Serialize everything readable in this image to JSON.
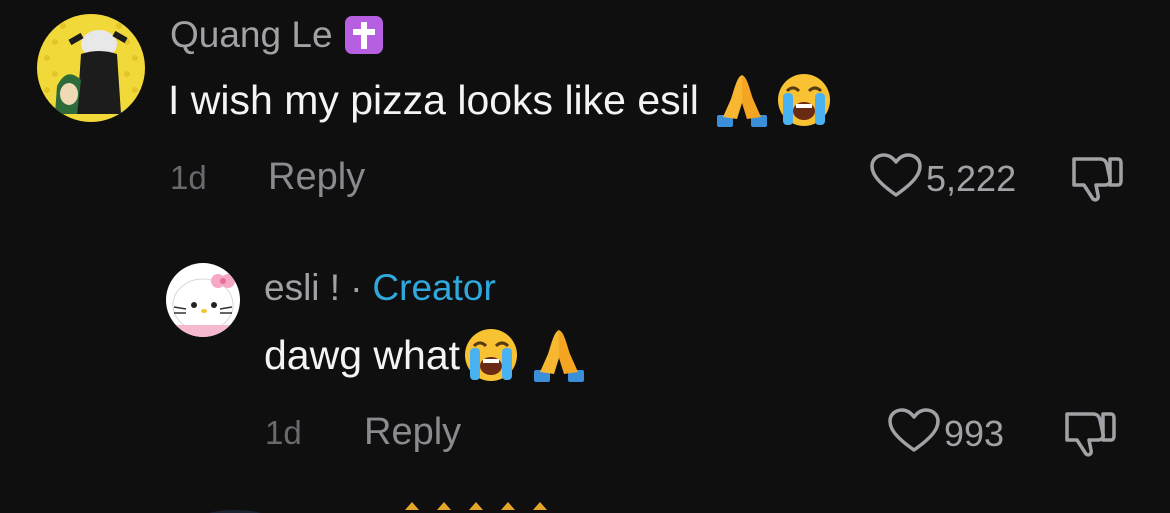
{
  "comments": [
    {
      "author": "Quang Le",
      "badge_icon": "latin-cross-icon",
      "text": "I wish my pizza looks like esil",
      "emojis": [
        "folded-hands-icon",
        "loudly-crying-face-icon"
      ],
      "time": "1d",
      "reply_label": "Reply",
      "likes": "5,222"
    },
    {
      "author": "esli !",
      "separator": "·",
      "role": "Creator",
      "text": "dawg what",
      "emojis": [
        "loudly-crying-face-icon",
        "folded-hands-icon"
      ],
      "time": "1d",
      "reply_label": "Reply",
      "likes": "993"
    }
  ],
  "colors": {
    "background": "#0f0f10",
    "creator": "#2fa9dd",
    "badge": "#b65fe0"
  }
}
